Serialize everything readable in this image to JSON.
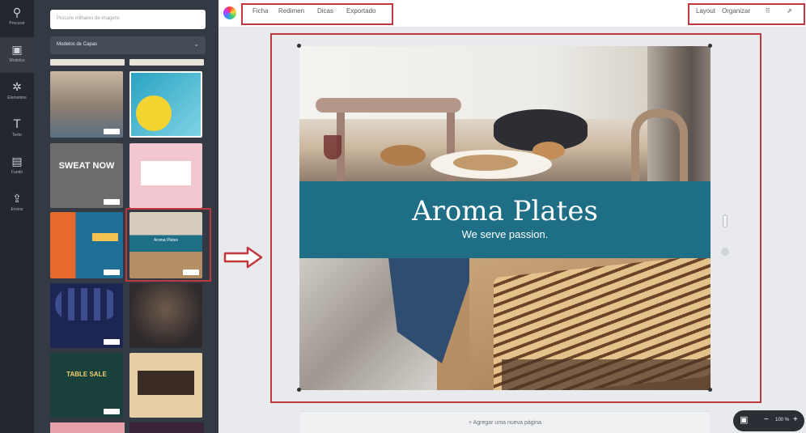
{
  "rail": {
    "items": [
      {
        "icon": "search-icon",
        "glyph": "⚲",
        "label": "Procurar"
      },
      {
        "icon": "layouts-icon",
        "glyph": "▣",
        "label": "Modelos"
      },
      {
        "icon": "elements-icon",
        "glyph": "✲",
        "label": "Elementos"
      },
      {
        "icon": "text-icon",
        "glyph": "T",
        "label": "Texto"
      },
      {
        "icon": "background-icon",
        "glyph": "▤",
        "label": "Fundo"
      },
      {
        "icon": "upload-icon",
        "glyph": "⇪",
        "label": "Envios"
      }
    ]
  },
  "panel": {
    "search_placeholder": "Procure milhares de imagens",
    "category_select": "Modelos de Capas",
    "thumbnails": [
      {
        "title": "",
        "bg": "#8a7e6f"
      },
      {
        "title": "",
        "bg": "#2aa3c2"
      },
      {
        "title": "SWEAT NOW",
        "bg": "#6c6c6c"
      },
      {
        "title": "",
        "bg": "#f3c7cf"
      },
      {
        "title": "",
        "bg": "#1f6f96"
      },
      {
        "title": "Aroma Plates",
        "bg": "#1e6e86"
      },
      {
        "title": "",
        "bg": "#1d2552"
      },
      {
        "title": "",
        "bg": "#2f2a2c"
      },
      {
        "title": "TABLE SALE",
        "bg": "#19403b"
      },
      {
        "title": "",
        "bg": "#e7cfa5"
      }
    ]
  },
  "topbar": {
    "menu": [
      "Ficha",
      "Redimen",
      "Dicas",
      "Exportado"
    ],
    "right": [
      "Layout",
      "Organizar",
      "⠿",
      "⇗"
    ]
  },
  "design": {
    "title": "Aroma Plates",
    "subtitle": "We serve passion.",
    "accent": "#1e6e86"
  },
  "footer": {
    "add_page": "+ Agregar uma nueva página",
    "zoom": "100 %",
    "minus": "−",
    "plus": "+"
  },
  "annotation_color": "#c1383c"
}
